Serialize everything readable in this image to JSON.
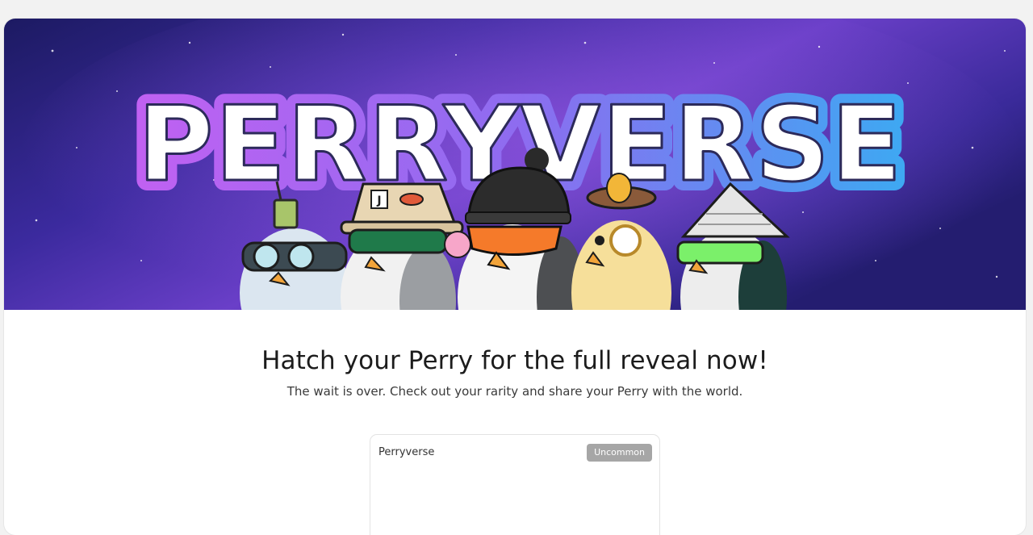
{
  "banner": {
    "logo_text": "PERRYVERSE",
    "hat_badge_letter": "J",
    "colors": {
      "sky_dark": "#1f1b6b",
      "sky_mid": "#4a2fb0",
      "sky_glow": "#8a4fd8",
      "logo_fill": "#ffffff",
      "logo_outline_left": "#b25bf0",
      "logo_outline_right": "#3fa4f0"
    }
  },
  "main": {
    "headline": "Hatch your Perry for the full reveal now!",
    "subline": "The wait is over. Check out your rarity and share your Perry with the world."
  },
  "item_card": {
    "name": "Perryverse",
    "rarity": "Uncommon",
    "rarity_color": "#a6a6a6"
  }
}
